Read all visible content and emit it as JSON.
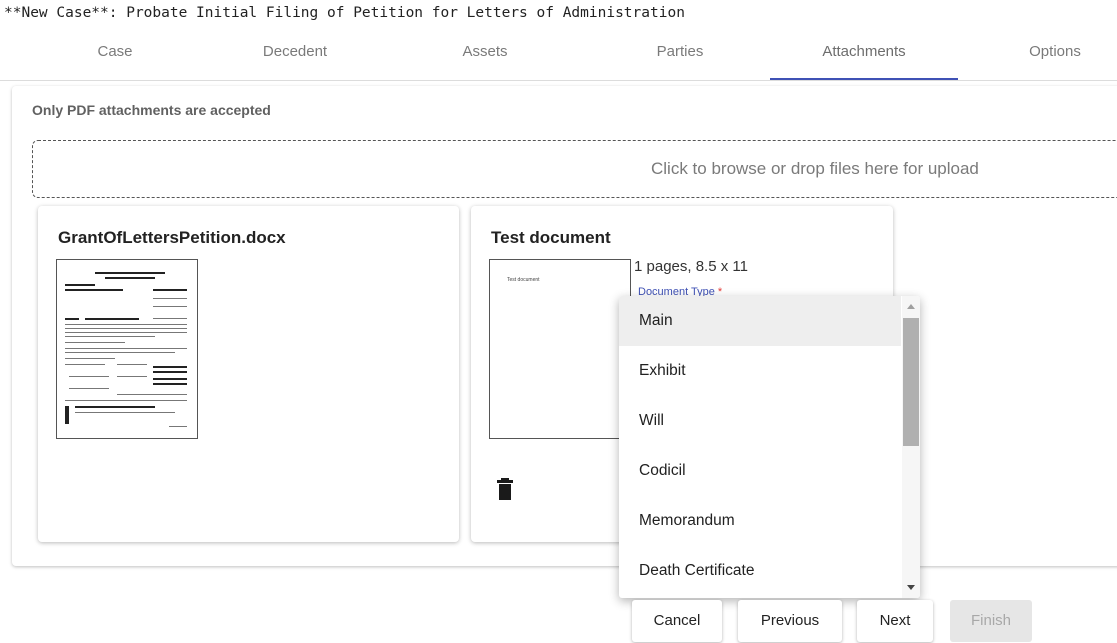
{
  "page": {
    "title": "**New Case**: Probate Initial Filing of Petition for Letters of Administration"
  },
  "tabs": [
    {
      "label": "Case"
    },
    {
      "label": "Decedent"
    },
    {
      "label": "Assets"
    },
    {
      "label": "Parties"
    },
    {
      "label": "Attachments",
      "active": true
    },
    {
      "label": "Options"
    }
  ],
  "attachments": {
    "notice": "Only PDF attachments are accepted",
    "dropzone_text": "Click to browse or drop files here for upload",
    "files": [
      {
        "name": "GrantOfLettersPetition.docx"
      },
      {
        "name": "Test document",
        "thumbnail_text": "Test document",
        "meta": "1 pages, 8.5 x 11",
        "document_type_label": "Document Type",
        "required_marker": "*",
        "delete_icon": "trash-icon"
      }
    ]
  },
  "dropdown": {
    "options": [
      "Main",
      "Exhibit",
      "Will",
      "Codicil",
      "Memorandum",
      "Death Certificate"
    ],
    "selected": "Main"
  },
  "footer": {
    "cancel": "Cancel",
    "previous": "Previous",
    "next": "Next",
    "finish": "Finish"
  },
  "colors": {
    "accent": "#3f51b5",
    "required": "#e53935"
  }
}
